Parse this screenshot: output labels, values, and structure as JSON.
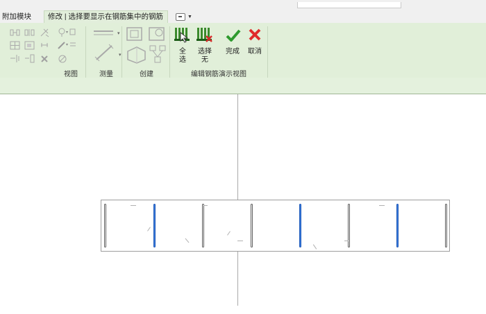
{
  "tabs": {
    "addin": "附加模块",
    "modify": "修改 | 选择要显示在钢筋集中的钢筋"
  },
  "panels": {
    "view": "视图",
    "measure": "测量",
    "create": "创建",
    "edit_rebar_view": "编辑钢筋演示视图"
  },
  "buttons": {
    "select_all_line1": "全",
    "select_all_line2": "选",
    "select_none_line1": "选择",
    "select_none_line2": "无",
    "finish": "完成",
    "cancel": "取消"
  },
  "colors": {
    "ribbon_bg": "#e1efd9",
    "finish_check": "#2e9a2e",
    "cancel_x": "#e02b2b",
    "selected_rebar": "#3a7ee0"
  },
  "icons": [
    "align-icon",
    "offset-icon",
    "split-icon",
    "grid-icon",
    "array-icon",
    "scale-icon",
    "pin-icon",
    "unpin-icon",
    "delete-icon",
    "hide-icon",
    "override-icon",
    "paint-icon",
    "line-style-icon",
    "measure-icon",
    "dimension-icon",
    "part-icon",
    "group-icon",
    "component-icon",
    "assembly-icon",
    "select-all-icon",
    "select-none-icon",
    "finish-check-icon",
    "cancel-x-icon"
  ],
  "rebar_section": {
    "bars": [
      {
        "selected": false
      },
      {
        "selected": true
      },
      {
        "selected": false
      },
      {
        "selected": false
      },
      {
        "selected": true
      },
      {
        "selected": false
      },
      {
        "selected": true
      },
      {
        "selected": false
      }
    ]
  }
}
